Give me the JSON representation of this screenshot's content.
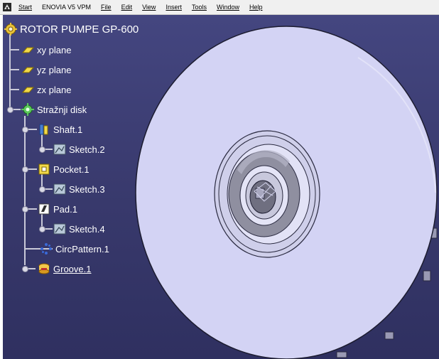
{
  "menubar": {
    "items": [
      "Start",
      "ENOVIA V5 VPM",
      "File",
      "Edit",
      "View",
      "Insert",
      "Tools",
      "Window",
      "Help"
    ]
  },
  "tree": {
    "root": "ROTOR PUMPE GP-600",
    "planes": [
      "xy plane",
      "yz plane",
      "zx plane"
    ],
    "body": "Stražnji disk",
    "features": [
      {
        "label": "Shaft.1",
        "sketch": "Sketch.2"
      },
      {
        "label": "Pocket.1",
        "sketch": "Sketch.3"
      },
      {
        "label": "Pad.1",
        "sketch": "Sketch.4"
      }
    ],
    "pattern": "CircPattern.1",
    "groove": "Groove.1"
  },
  "colors": {
    "background": "#3b3d73",
    "disk": "#d3d3f4",
    "hub": "#9a9aaa",
    "tree_text": "#ffffff"
  },
  "icons": {
    "start": "catia-start-icon",
    "root": "part-gear-icon",
    "plane": "plane-icon",
    "body": "body-gear-icon",
    "shaft": "shaft-icon",
    "pocket": "pocket-icon",
    "pad": "pad-icon",
    "sketch": "sketch-icon",
    "pattern": "circpattern-icon",
    "groove": "groove-icon"
  }
}
